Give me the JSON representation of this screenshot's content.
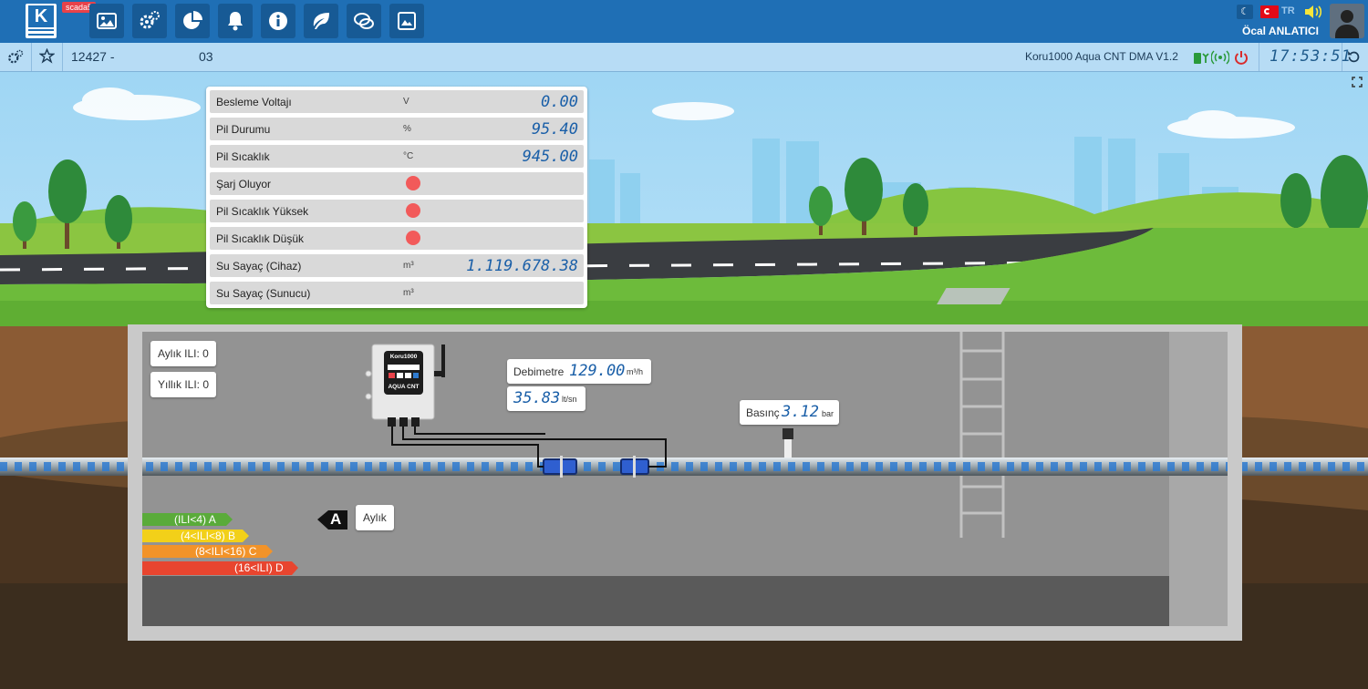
{
  "header": {
    "badge": "scada5",
    "nav_icons": [
      "image-icon",
      "gears-icon",
      "pie-chart-icon",
      "bell-icon",
      "info-icon",
      "leaf-icon",
      "chat-icon",
      "picture-icon"
    ],
    "lang": "TR",
    "user_name": "Öcal ANLATICI",
    "colors": {
      "topbar": "#1f6fb5",
      "button": "#175a95"
    }
  },
  "subbar": {
    "id": "12427 -",
    "code": "03",
    "device": "Koru1000 Aqua CNT DMA V1.2",
    "time": "17:53:51"
  },
  "panel": {
    "rows": [
      {
        "label": "Besleme Voltajı",
        "unit": "V",
        "value": "0.00"
      },
      {
        "label": "Pil Durumu",
        "unit": "%",
        "value": "95.40"
      },
      {
        "label": "Pil Sıcaklık",
        "unit": "°C",
        "value": "945.00"
      },
      {
        "label": "Şarj Oluyor",
        "status": "red"
      },
      {
        "label": "Pil Sıcaklık Yüksek",
        "status": "red"
      },
      {
        "label": "Pil Sıcaklık Düşük",
        "status": "red"
      },
      {
        "label": "Su Sayaç (Cihaz)",
        "unit": "m³",
        "value": "1.119.678.38"
      },
      {
        "label": "Su Sayaç (Sunucu)",
        "unit": "m³",
        "value": ""
      }
    ]
  },
  "scene": {
    "aylik_ili": "Aylık ILI: 0",
    "yillik_ili": "Yıllık ILI: 0",
    "debimetre_label": "Debimetre",
    "debimetre_value": "129.00",
    "debimetre_unit": "m³/h",
    "flow_value": "35.83",
    "flow_unit": "lt/sn",
    "basinc_label": "Basınç",
    "basinc_value": "3.12",
    "basinc_unit": "bar",
    "device_brand": "Koru1000",
    "device_model": "AQUA CNT",
    "grade_letter": "A",
    "grade_period": "Aylık",
    "ili_scale": [
      {
        "label": "(ILI<4) A",
        "color": "#5aab3a"
      },
      {
        "label": "(4<ILI<8) B",
        "color": "#f2d019"
      },
      {
        "label": "(8<ILI<16) C",
        "color": "#f29329"
      },
      {
        "label": "(16<ILI) D",
        "color": "#e8452f"
      }
    ]
  }
}
